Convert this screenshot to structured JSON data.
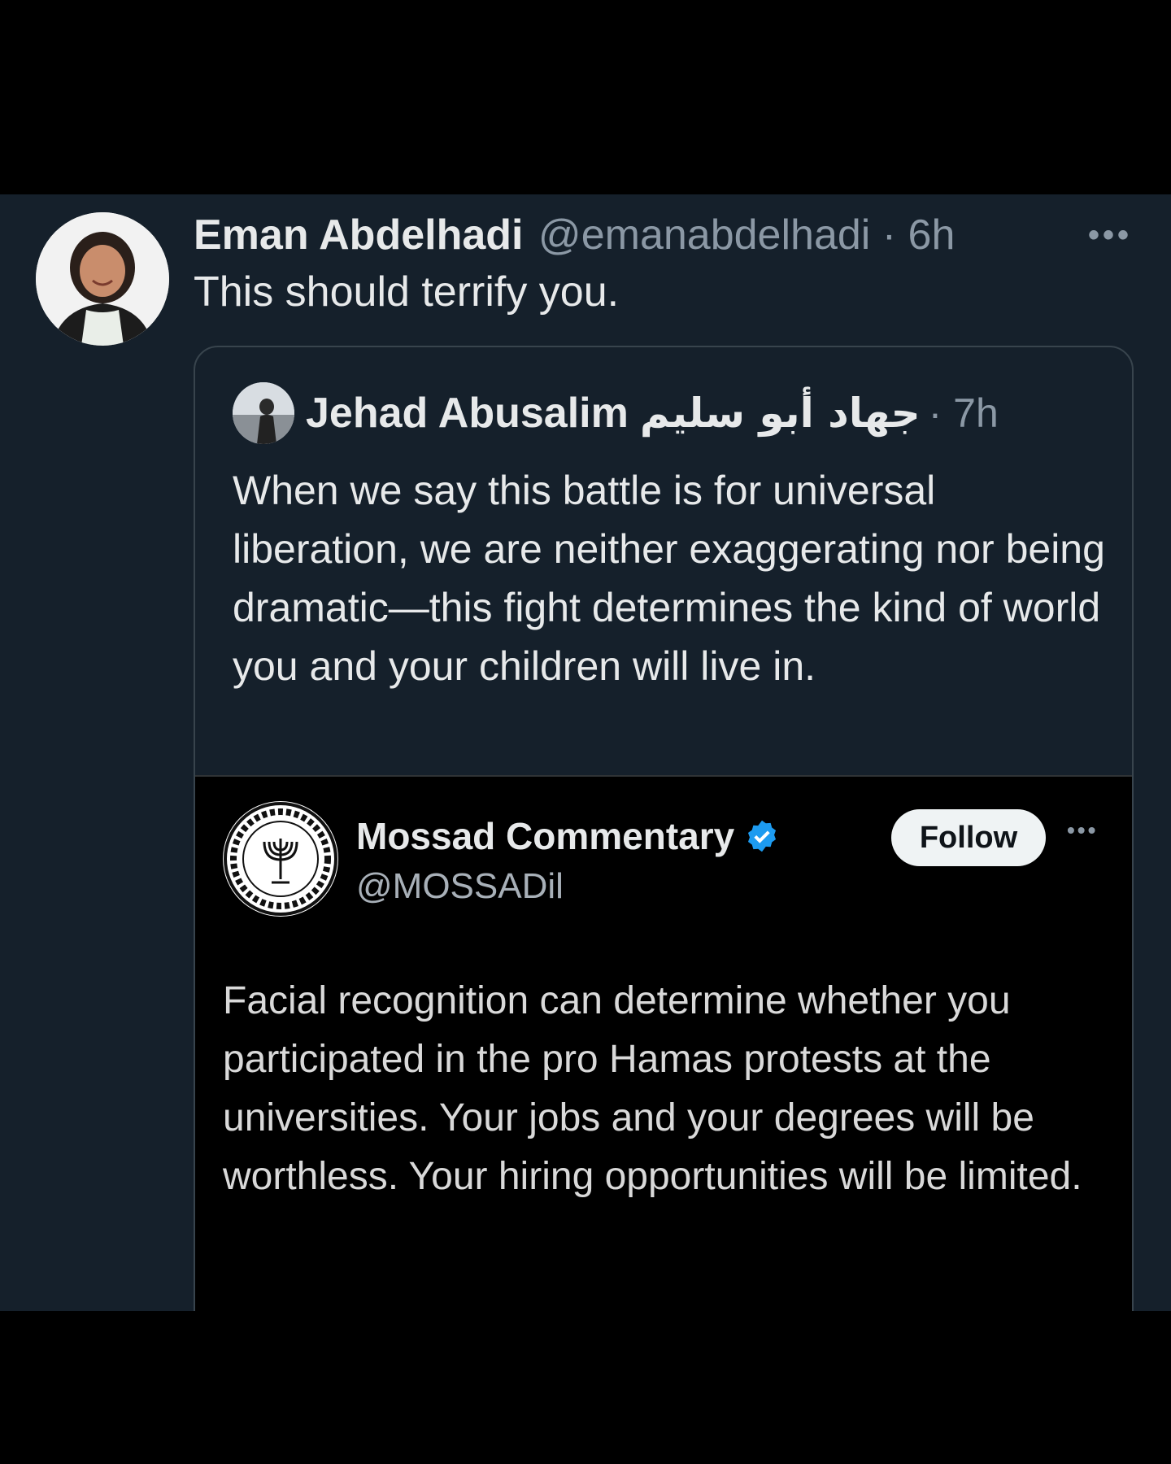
{
  "tweet": {
    "author": {
      "display_name": "Eman Abdelhadi",
      "handle_time": "@emanabdelhadi · 6h"
    },
    "more_icon": "more-horizontal-icon",
    "text": "This should terrify you."
  },
  "quote": {
    "author": {
      "display_name": "Jehad Abusalim",
      "arabic_name": "جهاد أبو سليم",
      "time": "· 7h"
    },
    "text": "When we say this battle is for universal liberation, we are neither exaggerating nor being dramatic—this fight determines the kind of world you and your children will live in."
  },
  "embedded": {
    "display_name": "Mossad Commentary",
    "handle": "@MOSSADil",
    "follow_label": "Follow",
    "verified_icon": "verified-badge-icon",
    "text": "Facial recognition can determine whether you participated in the pro Hamas protests at the universities. Your jobs and your degrees will be worthless. Your hiring opportunities will be limited."
  },
  "colors": {
    "background": "#15202b",
    "verified": "#1d9bf0"
  }
}
